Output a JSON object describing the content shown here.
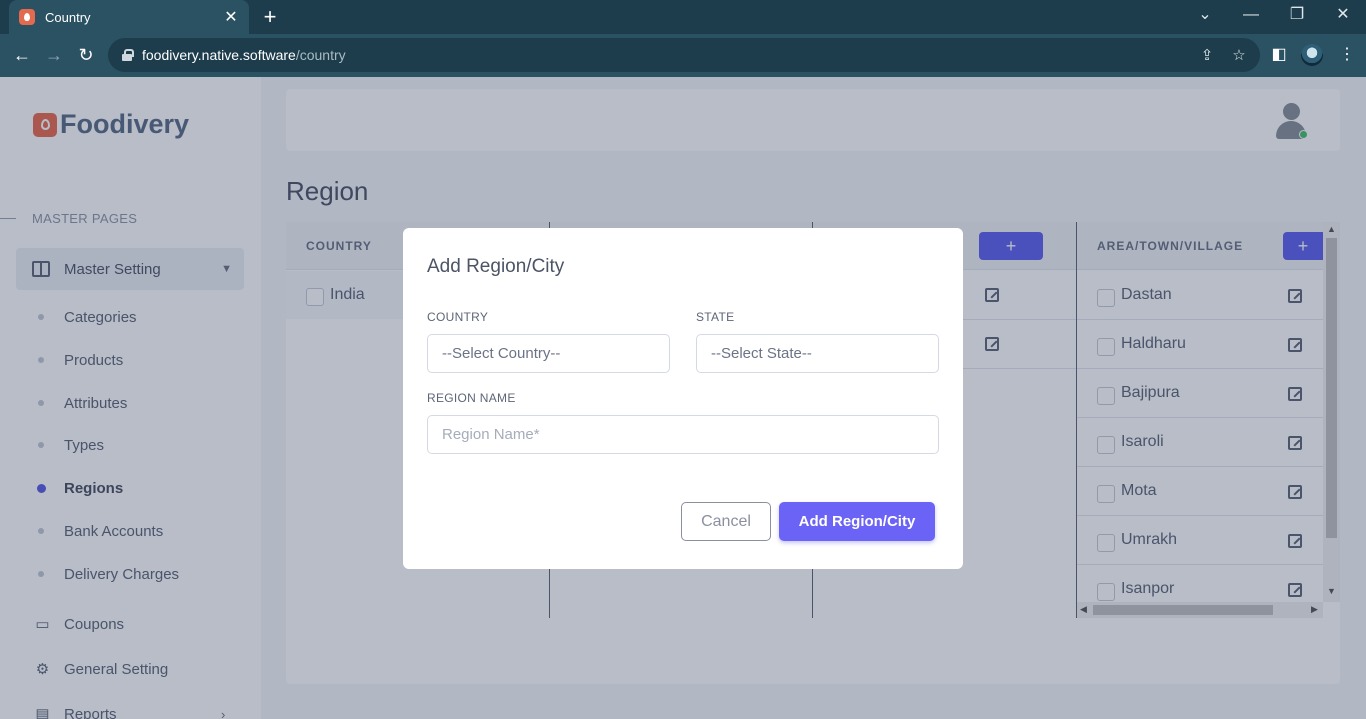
{
  "browser": {
    "tab_title": "Country",
    "url_host": "foodivery.native.software",
    "url_path": "/country"
  },
  "sidebar": {
    "brand": "Foodivery",
    "section": "MASTER PAGES",
    "master_label": "Master Setting",
    "sub_items": [
      "Categories",
      "Products",
      "Attributes",
      "Types",
      "Regions",
      "Bank Accounts",
      "Delivery Charges"
    ],
    "active_sub_item": "Regions",
    "nav_items": [
      {
        "label": "Coupons",
        "icon": "ticket-icon"
      },
      {
        "label": "General Setting",
        "icon": "gear-icon"
      },
      {
        "label": "Reports",
        "icon": "report-icon"
      }
    ]
  },
  "page": {
    "title": "Region",
    "columns": {
      "country": "COUNTRY",
      "area": "AREA/TOWN/VILLAGE"
    },
    "add_symbol": "+",
    "country_rows": [
      "India"
    ],
    "area_rows": [
      "Dastan",
      "Haldharu",
      "Bajipura",
      "Isaroli",
      "Mota",
      "Umrakh",
      "Isanpor"
    ]
  },
  "modal": {
    "title": "Add Region/City",
    "country_label": "COUNTRY",
    "country_value": "--Select Country--",
    "state_label": "STATE",
    "state_value": "--Select State--",
    "region_label": "REGION NAME",
    "region_placeholder": "Region Name*",
    "cancel_label": "Cancel",
    "submit_label": "Add Region/City"
  },
  "colors": {
    "accent": "#6a63f6",
    "browser_bg": "#1d3c4c",
    "brand": "#ea6b4f"
  }
}
